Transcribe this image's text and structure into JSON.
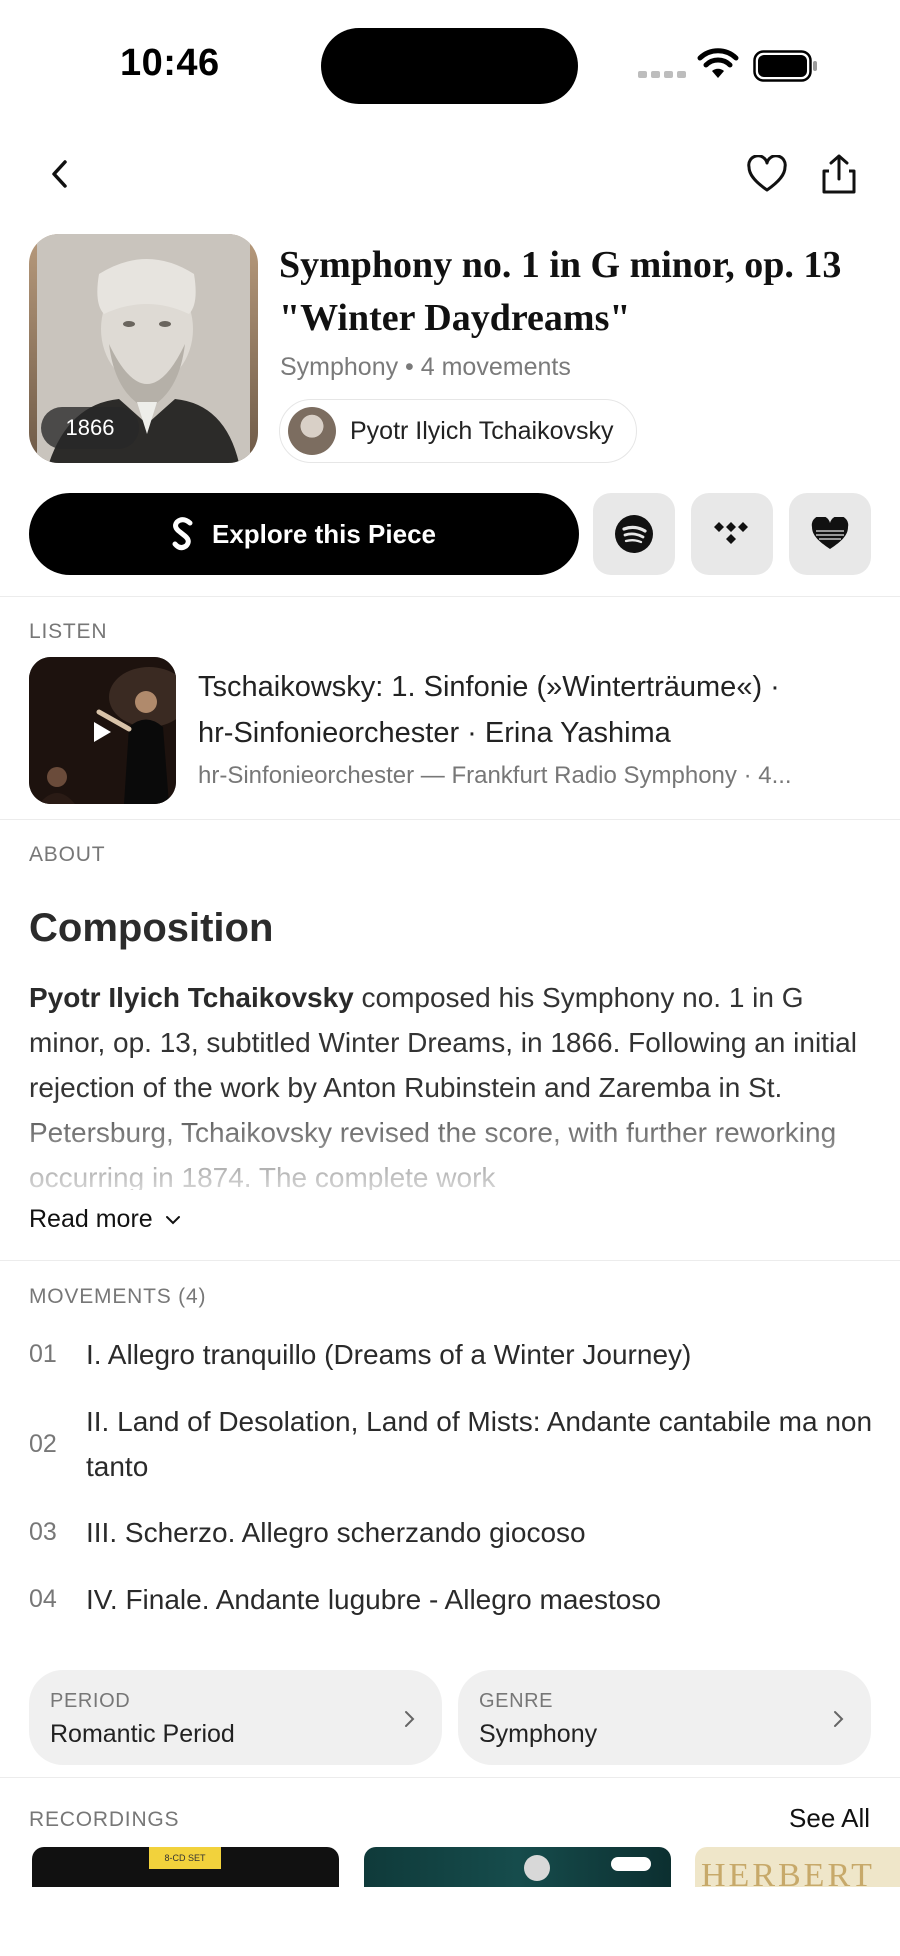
{
  "status_bar": {
    "time": "10:46"
  },
  "nav": {
    "back_icon": "chevron-left-icon",
    "favorite_icon": "heart-icon",
    "share_icon": "share-icon"
  },
  "work": {
    "title": "Symphony no. 1 in G minor, op. 13 \"Winter Daydreams\"",
    "subtitle": "Symphony • 4 movements",
    "year": "1866",
    "composer": "Pyotr Ilyich Tchaikovsky"
  },
  "actions": {
    "explore_label": "Explore this Piece",
    "services": [
      "spotify-icon",
      "tidal-icon",
      "deezer-icon"
    ]
  },
  "listen": {
    "label": "LISTEN",
    "title_line1": "Tschaikowsky: 1. Sinfonie (»Winterträume«) ·",
    "title_line2": "hr-Sinfonieorchester · Erina Yashima",
    "subtitle": "hr-Sinfonieorchester — Frankfurt Radio Symphony · 4..."
  },
  "about": {
    "label": "ABOUT",
    "heading": "Composition",
    "composer_bold": "Pyotr Ilyich Tchaikovsky",
    "text": " composed his Symphony no. 1 in G minor, op. 13, subtitled Winter Dreams, in 1866. Following an initial rejection of the work by Anton Rubinstein and Zaremba in St. Petersburg, Tchaikovsky revised the score, with further reworking occurring in 1874. The complete work",
    "read_more": "Read more"
  },
  "movements": {
    "label": "MOVEMENTS (4)",
    "items": [
      {
        "num": "01",
        "title": "I. Allegro tranquillo (Dreams of a Winter Journey)"
      },
      {
        "num": "02",
        "title": "II. Land of Desolation, Land of Mists: Andante cantabile ma non tanto"
      },
      {
        "num": "03",
        "title": "III. Scherzo. Allegro scherzando giocoso"
      },
      {
        "num": "04",
        "title": "IV. Finale. Andante lugubre - Allegro maestoso"
      }
    ]
  },
  "tags": [
    {
      "label": "PERIOD",
      "value": "Romantic Period"
    },
    {
      "label": "GENRE",
      "value": "Symphony"
    }
  ],
  "recordings": {
    "label": "RECORDINGS",
    "see_all": "See All",
    "cover_texts": [
      "8-CD SET",
      "HERBERT"
    ]
  }
}
